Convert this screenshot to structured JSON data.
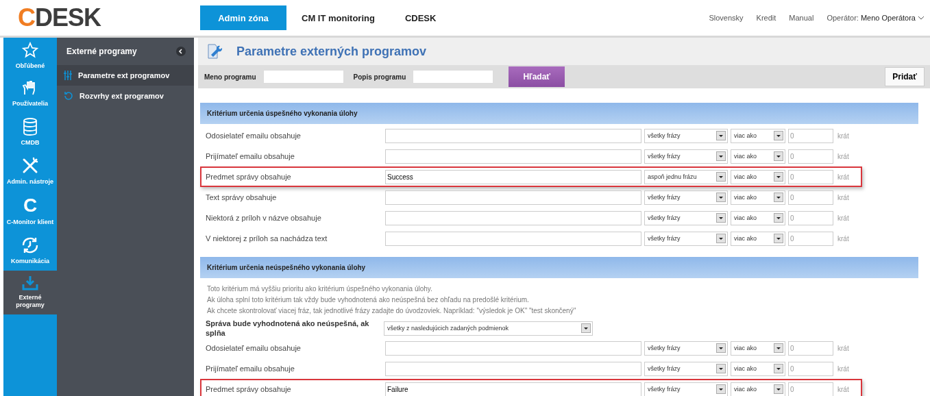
{
  "logo": {
    "accent": "C",
    "rest": "DESK"
  },
  "nav": [
    {
      "label": "Admin zóna",
      "selected": true
    },
    {
      "label": "CM IT monitoring",
      "selected": false
    },
    {
      "label": "CDESK",
      "selected": false
    }
  ],
  "top_links": [
    "Slovensky",
    "Kredit",
    "Manual"
  ],
  "operator": {
    "label": "Operátor:",
    "name": "Meno Operátora"
  },
  "rail": [
    {
      "label": "Obľúbené",
      "kind": "star",
      "selected": false
    },
    {
      "label": "Používatelia",
      "kind": "hand",
      "selected": false
    },
    {
      "label": "CMDB",
      "kind": "database",
      "selected": false
    },
    {
      "label": "Admin. nástroje",
      "kind": "tools",
      "selected": false
    },
    {
      "label": "C-Monitor klient",
      "kind": "letter",
      "glyph": "C",
      "selected": false
    },
    {
      "label": "Komunikácia",
      "kind": "clock",
      "selected": false
    },
    {
      "label": "Externé programy",
      "kind": "download",
      "selected": true
    }
  ],
  "panel": {
    "title": "Externé programy",
    "items": [
      {
        "label": "Parametre ext programov",
        "kind": "sliders",
        "selected": true
      },
      {
        "label": "Rozvrhy ext programov",
        "kind": "history",
        "selected": false
      }
    ]
  },
  "page_title": "Parametre externých programov",
  "filter": {
    "fields": [
      {
        "label": "Meno programu"
      },
      {
        "label": "Popis programu"
      }
    ],
    "search_button": "Hľadať",
    "add_button": "Pridať"
  },
  "sections": [
    {
      "title": "Kritérium určenia úspešného vykonania úlohy",
      "rows": [
        {
          "label": "Odosielateľ emailu obsahuje",
          "match": "všetky frázy",
          "compare": "viac ako",
          "count": "0",
          "unit": "krát",
          "highlighted": false
        },
        {
          "label": "Prijímateľ emailu obsahuje",
          "match": "všetky frázy",
          "compare": "viac ako",
          "count": "0",
          "unit": "krát",
          "highlighted": false
        },
        {
          "label": "Predmet správy obsahuje",
          "value": "Success",
          "match": "aspoň jednu frázu",
          "compare": "viac ako",
          "count": "0",
          "unit": "krát",
          "highlighted": true
        },
        {
          "label": "Text správy obsahuje",
          "match": "všetky frázy",
          "compare": "viac ako",
          "count": "0",
          "unit": "krát",
          "highlighted": false
        },
        {
          "label": "Niektorá z príloh v názve obsahuje",
          "match": "všetky frázy",
          "compare": "viac ako",
          "count": "0",
          "unit": "krát",
          "highlighted": false
        },
        {
          "label": "V niektorej z príloh sa nachádza text",
          "match": "všetky frázy",
          "compare": "viac ako",
          "count": "0",
          "unit": "krát",
          "highlighted": false
        }
      ]
    },
    {
      "title": "Kritérium určenia neúspešného vykonania úlohy",
      "notes": [
        "Toto kritérium má vyššiu prioritu ako kritérium úspešného vykonania úlohy.",
        "Ak úloha splní toto kritérium tak vždy bude vyhodnotená ako neúspešná bez ohľadu na predošlé kritérium.",
        "Ak chcete skontrolovať viacej fráz, tak jednotlivé frázy zadajte do úvodzoviek. Napríklad: \"výsledok je OK\" \"test skončený\""
      ],
      "condition": {
        "label": "Správa bude vyhodnotená ako neúspešná, ak splňa",
        "value": "všetky z nasledujúcich zadaných podmienok"
      },
      "rows": [
        {
          "label": "Odosielateľ emailu obsahuje",
          "match": "všetky frázy",
          "compare": "viac ako",
          "count": "0",
          "unit": "krát",
          "highlighted": false
        },
        {
          "label": "Prijímateľ emailu obsahuje",
          "match": "všetky frázy",
          "compare": "viac ako",
          "count": "0",
          "unit": "krát",
          "highlighted": false
        },
        {
          "label": "Predmet správy obsahuje",
          "value": "Failure",
          "match": "všetky frázy",
          "compare": "viac ako",
          "count": "0",
          "unit": "krát",
          "highlighted": true
        }
      ]
    }
  ]
}
